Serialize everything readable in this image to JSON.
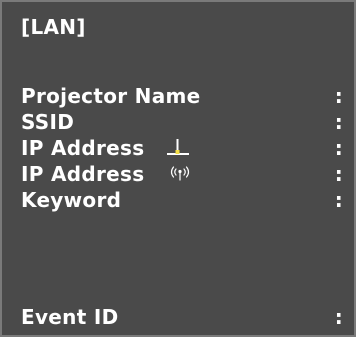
{
  "panel": {
    "title": "[LAN]",
    "rows": [
      {
        "label": "Projector Name",
        "separator": ":"
      },
      {
        "label": "SSID",
        "separator": ":"
      },
      {
        "label": "IP Address",
        "icon": "wired-lan-icon",
        "separator": ":"
      },
      {
        "label": "IP Address",
        "icon": "wireless-lan-icon",
        "separator": ":"
      },
      {
        "label": "Keyword",
        "separator": ":"
      },
      {
        "label": "Event ID",
        "separator": ":"
      }
    ]
  },
  "colors": {
    "background": "#4a4a4a",
    "border": "#7a7a7a",
    "text": "#ffffff",
    "indicator": "#f5e04a"
  }
}
